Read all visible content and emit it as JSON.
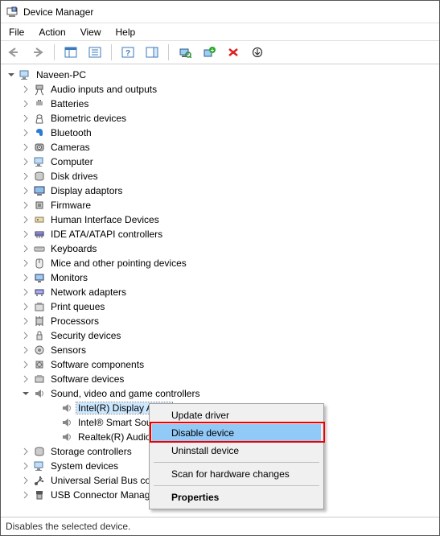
{
  "title": "Device Manager",
  "menu": {
    "file": "File",
    "action": "Action",
    "view": "View",
    "help": "Help"
  },
  "root": "Naveen-PC",
  "categories": [
    "Audio inputs and outputs",
    "Batteries",
    "Biometric devices",
    "Bluetooth",
    "Cameras",
    "Computer",
    "Disk drives",
    "Display adaptors",
    "Firmware",
    "Human Interface Devices",
    "IDE ATA/ATAPI controllers",
    "Keyboards",
    "Mice and other pointing devices",
    "Monitors",
    "Network adapters",
    "Print queues",
    "Processors",
    "Security devices",
    "Sensors",
    "Software components",
    "Software devices"
  ],
  "expandedCategory": "Sound, video and game controllers",
  "expandedChildren": [
    "Intel(R) Display Audio",
    "Intel® Smart Sound Technology",
    "Realtek(R) Audio"
  ],
  "tailCategories": [
    "Storage controllers",
    "System devices",
    "Universal Serial Bus controllers",
    "USB Connector Manager"
  ],
  "context": {
    "update": "Update driver",
    "disable": "Disable device",
    "uninstall": "Uninstall device",
    "scan": "Scan for hardware changes",
    "properties": "Properties"
  },
  "status": "Disables the selected device."
}
